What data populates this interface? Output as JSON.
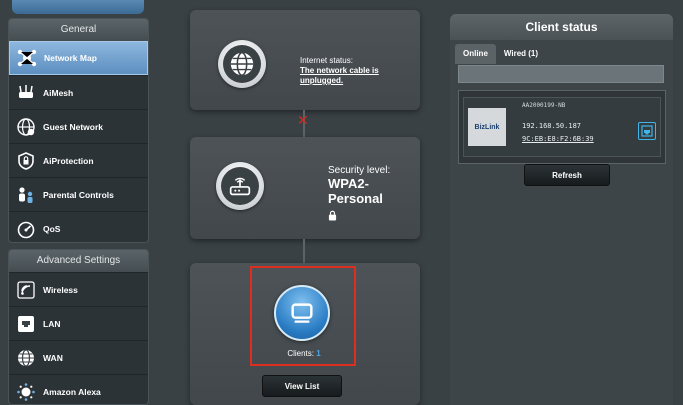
{
  "sidebar": {
    "general_header": "General",
    "general_items": [
      {
        "label": "Network Map",
        "icon": "network-map-icon",
        "active": true
      },
      {
        "label": "AiMesh",
        "icon": "aimesh-icon"
      },
      {
        "label": "Guest Network",
        "icon": "guest-network-icon"
      },
      {
        "label": "AiProtection",
        "icon": "shield-icon"
      },
      {
        "label": "Parental Controls",
        "icon": "parental-controls-icon"
      },
      {
        "label": "QoS",
        "icon": "qos-gauge-icon"
      }
    ],
    "advanced_header": "Advanced Settings",
    "advanced_items": [
      {
        "label": "Wireless",
        "icon": "wireless-icon"
      },
      {
        "label": "LAN",
        "icon": "lan-icon"
      },
      {
        "label": "WAN",
        "icon": "wan-globe-icon"
      },
      {
        "label": "Amazon Alexa",
        "icon": "alexa-icon"
      }
    ]
  },
  "map": {
    "internet": {
      "status_label": "Internet status:",
      "status_value": "The network cable is unplugged."
    },
    "router": {
      "security_label": "Security level:",
      "security_value": "WPA2-Personal"
    },
    "clients": {
      "label": "Clients:",
      "count": "1",
      "view_list": "View List"
    }
  },
  "client_status": {
    "title": "Client status",
    "tabs": [
      "Online",
      "Wired (1)"
    ],
    "active_tab": "Online",
    "client": {
      "logo_text": "BizLink",
      "name": "AA2000199-NB",
      "ip": "192.168.50.187",
      "mac": "9C:EB:E8:F2:6B:39"
    },
    "refresh": "Refresh"
  },
  "colors": {
    "accent_blue": "#5d8fc0",
    "client_count": "#4fa8e8",
    "error_red": "#d42a22",
    "highlight_red": "#e02d22"
  }
}
